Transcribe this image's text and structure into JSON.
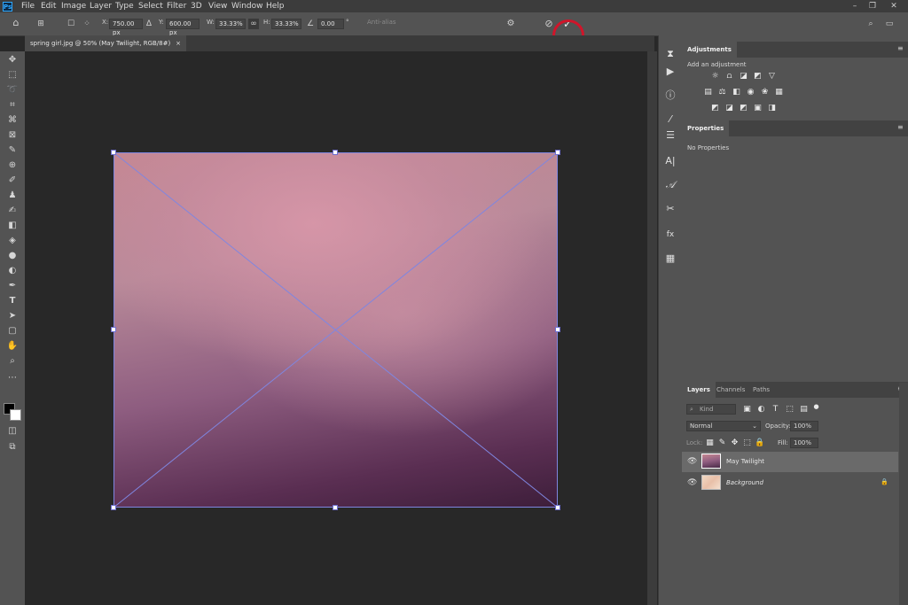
{
  "menubar": {
    "logo": "Ps",
    "items": [
      "File",
      "Edit",
      "Image",
      "Layer",
      "Type",
      "Select",
      "Filter",
      "3D",
      "View",
      "Window",
      "Help"
    ],
    "controls": {
      "minimize": "–",
      "restore": "❐",
      "close": "✕"
    }
  },
  "options": {
    "x_label": "X:",
    "x_value": "750.00 px",
    "y_label": "Y:",
    "y_value": "600.00 px",
    "w_label": "W:",
    "w_value": "33.33%",
    "h_label": "H:",
    "h_value": "33.33%",
    "angle_value": "0.00",
    "angle_unit": "°",
    "interp_label": "Anti-alias",
    "cancel_icon": "⃠",
    "commit_icon": "✓"
  },
  "document": {
    "tab_label": "spring girl.jpg @ 50% (May Twilight, RGB/8#)",
    "tab_close": "×"
  },
  "panels": {
    "adjustments": {
      "title": "Adjustments",
      "subtitle": "Add an adjustment"
    },
    "properties": {
      "title": "Properties",
      "text": "No Properties"
    },
    "layers": {
      "tabs": [
        "Layers",
        "Channels",
        "Paths"
      ],
      "filter_placeholder": "Kind",
      "blend_mode": "Normal",
      "opacity_label": "Opacity:",
      "opacity_value": "100%",
      "lock_label": "Lock:",
      "fill_label": "Fill:",
      "fill_value": "100%",
      "rows": [
        {
          "name": "May Twilight",
          "selected": true
        },
        {
          "name": "Background",
          "locked": true
        }
      ]
    }
  },
  "colors": {
    "accent_red": "#d0152a",
    "transform_line": "#6f6fcf",
    "ui_panel": "#535353",
    "canvas": "#282828"
  }
}
